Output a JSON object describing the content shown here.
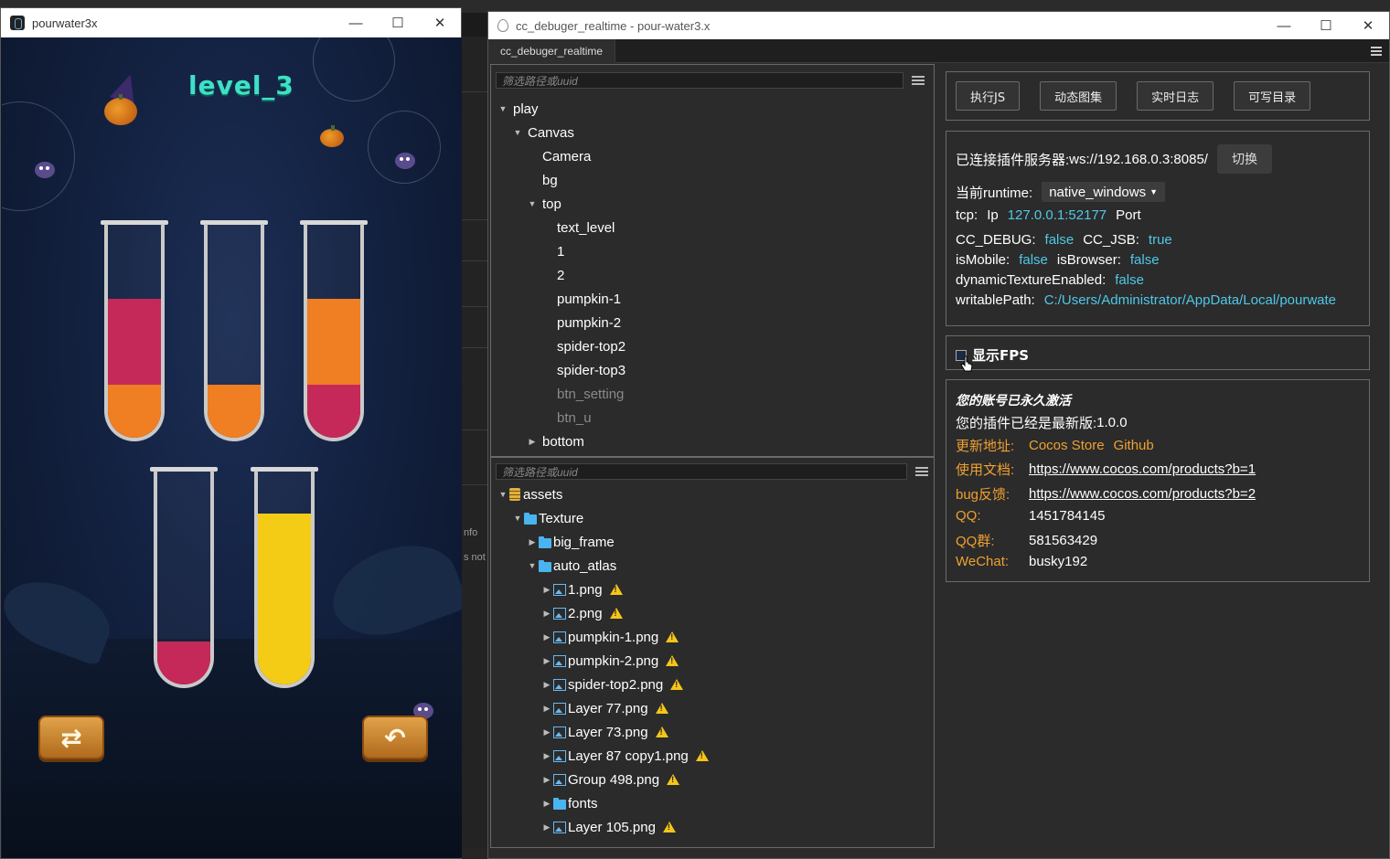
{
  "background": {
    "side_labels": [
      "nfo",
      "s not"
    ]
  },
  "game_window": {
    "title": "pourwater3x",
    "controls": {
      "minimize": "—",
      "maximize": "☐",
      "close": "✕"
    },
    "level_text": "level_3",
    "tubes": [
      {
        "layers_bottom_to_top": [
          {
            "color": "#f07e22",
            "fraction": 0.25
          },
          {
            "color": "#c4295a",
            "fraction": 0.4
          }
        ]
      },
      {
        "layers_bottom_to_top": [
          {
            "color": "#f07e22",
            "fraction": 0.25
          }
        ]
      },
      {
        "layers_bottom_to_top": [
          {
            "color": "#c4295a",
            "fraction": 0.25
          },
          {
            "color": "#f07e22",
            "fraction": 0.4
          }
        ]
      },
      {
        "layers_bottom_to_top": [
          {
            "color": "#c4295a",
            "fraction": 0.2
          }
        ]
      },
      {
        "layers_bottom_to_top": [
          {
            "color": "#f4cc16",
            "fraction": 0.8
          }
        ]
      }
    ],
    "buttons": {
      "restart_icon": "⇄",
      "undo_icon": "↶"
    }
  },
  "debugger_window": {
    "title": "cc_debuger_realtime - pour-water3.x",
    "controls": {
      "minimize": "—",
      "maximize": "☐",
      "close": "✕"
    },
    "tab": "cc_debuger_realtime",
    "node_filter_placeholder": "筛选路径或uuid",
    "asset_filter_placeholder": "筛选路径或uuid",
    "node_tree": [
      {
        "label": "play",
        "depth": 0,
        "arrow": "▼",
        "dim": false
      },
      {
        "label": "Canvas",
        "depth": 1,
        "arrow": "▼",
        "dim": false
      },
      {
        "label": "Camera",
        "depth": 2,
        "arrow": "",
        "dim": false
      },
      {
        "label": "bg",
        "depth": 2,
        "arrow": "",
        "dim": false
      },
      {
        "label": "top",
        "depth": 2,
        "arrow": "▼",
        "dim": false
      },
      {
        "label": "text_level",
        "depth": 3,
        "arrow": "",
        "dim": false
      },
      {
        "label": "1",
        "depth": 3,
        "arrow": "",
        "dim": false
      },
      {
        "label": "2",
        "depth": 3,
        "arrow": "",
        "dim": false
      },
      {
        "label": "pumpkin-1",
        "depth": 3,
        "arrow": "",
        "dim": false
      },
      {
        "label": "pumpkin-2",
        "depth": 3,
        "arrow": "",
        "dim": false
      },
      {
        "label": "spider-top2",
        "depth": 3,
        "arrow": "",
        "dim": false
      },
      {
        "label": "spider-top3",
        "depth": 3,
        "arrow": "",
        "dim": false
      },
      {
        "label": "btn_setting",
        "depth": 3,
        "arrow": "",
        "dim": true
      },
      {
        "label": "btn_u",
        "depth": 3,
        "arrow": "",
        "dim": true
      },
      {
        "label": "bottom",
        "depth": 2,
        "arrow": "▶",
        "dim": false
      }
    ],
    "asset_tree": [
      {
        "label": "assets",
        "depth": 0,
        "arrow": "▼",
        "icon": "database",
        "warn": false
      },
      {
        "label": "Texture",
        "depth": 1,
        "arrow": "▼",
        "icon": "folder",
        "warn": false
      },
      {
        "label": "big_frame",
        "depth": 2,
        "arrow": "▶",
        "icon": "folder",
        "warn": false
      },
      {
        "label": "auto_atlas",
        "depth": 2,
        "arrow": "▼",
        "icon": "folder",
        "warn": false
      },
      {
        "label": "1.png",
        "depth": 3,
        "arrow": "▶",
        "icon": "image",
        "warn": true
      },
      {
        "label": "2.png",
        "depth": 3,
        "arrow": "▶",
        "icon": "image",
        "warn": true
      },
      {
        "label": "pumpkin-1.png",
        "depth": 3,
        "arrow": "▶",
        "icon": "image",
        "warn": true
      },
      {
        "label": "pumpkin-2.png",
        "depth": 3,
        "arrow": "▶",
        "icon": "image",
        "warn": true
      },
      {
        "label": "spider-top2.png",
        "depth": 3,
        "arrow": "▶",
        "icon": "image",
        "warn": true
      },
      {
        "label": "Layer 77.png",
        "depth": 3,
        "arrow": "▶",
        "icon": "image",
        "warn": true
      },
      {
        "label": "Layer 73.png",
        "depth": 3,
        "arrow": "▶",
        "icon": "image",
        "warn": true
      },
      {
        "label": "Layer 87 copy1.png",
        "depth": 3,
        "arrow": "▶",
        "icon": "image",
        "warn": true
      },
      {
        "label": "Group 498.png",
        "depth": 3,
        "arrow": "▶",
        "icon": "image",
        "warn": true
      },
      {
        "label": "fonts",
        "depth": 3,
        "arrow": "▶",
        "icon": "folder",
        "warn": false
      },
      {
        "label": "Layer 105.png",
        "depth": 3,
        "arrow": "▶",
        "icon": "image",
        "warn": true
      }
    ],
    "action_buttons": [
      "执行JS",
      "动态图集",
      "实时日志",
      "可写目录"
    ],
    "connection": {
      "server_label": "已连接插件服务器:",
      "server_value": "ws://192.168.0.3:8085/",
      "switch_button": "切换",
      "runtime_label": "当前runtime:",
      "runtime_value": "native_windows",
      "tcp_label": "tcp:",
      "ip_label": "Ip",
      "ip_value": "127.0.0.1:52177",
      "port_label": "Port",
      "cc_debug_label": "CC_DEBUG:",
      "cc_debug_value": "false",
      "cc_jsb_label": "CC_JSB:",
      "cc_jsb_value": "true",
      "is_mobile_label": "isMobile:",
      "is_mobile_value": "false",
      "is_browser_label": "isBrowser:",
      "is_browser_value": "false",
      "dynamic_texture_label": "dynamicTextureEnabled:",
      "dynamic_texture_value": "false",
      "writable_path_label": "writablePath:",
      "writable_path_value": "C:/Users/Administrator/AppData/Local/pourwate"
    },
    "fps": {
      "label": "显示FPS",
      "checked": false
    },
    "account": {
      "status": "您的账号已永久激活",
      "version_label": "您的插件已经是最新版:",
      "version_value": "1.0.0",
      "update_label": "更新地址:",
      "update_store": "Cocos Store",
      "update_github": "Github",
      "docs_label": "使用文档:",
      "docs_url": "https://www.cocos.com/products?b=1",
      "bug_label": "bug反馈:",
      "bug_url": "https://www.cocos.com/products?b=2",
      "qq_label": "QQ:",
      "qq_value": "1451784145",
      "qq_group_label": "QQ群:",
      "qq_group_value": "581563429",
      "wechat_label": "WeChat:",
      "wechat_value": "busky192"
    },
    "colors": {
      "accent_cyan": "#4fc8e8",
      "accent_orange": "#f0a030",
      "warning": "#f5c518",
      "folder": "#4ab4f0"
    }
  }
}
